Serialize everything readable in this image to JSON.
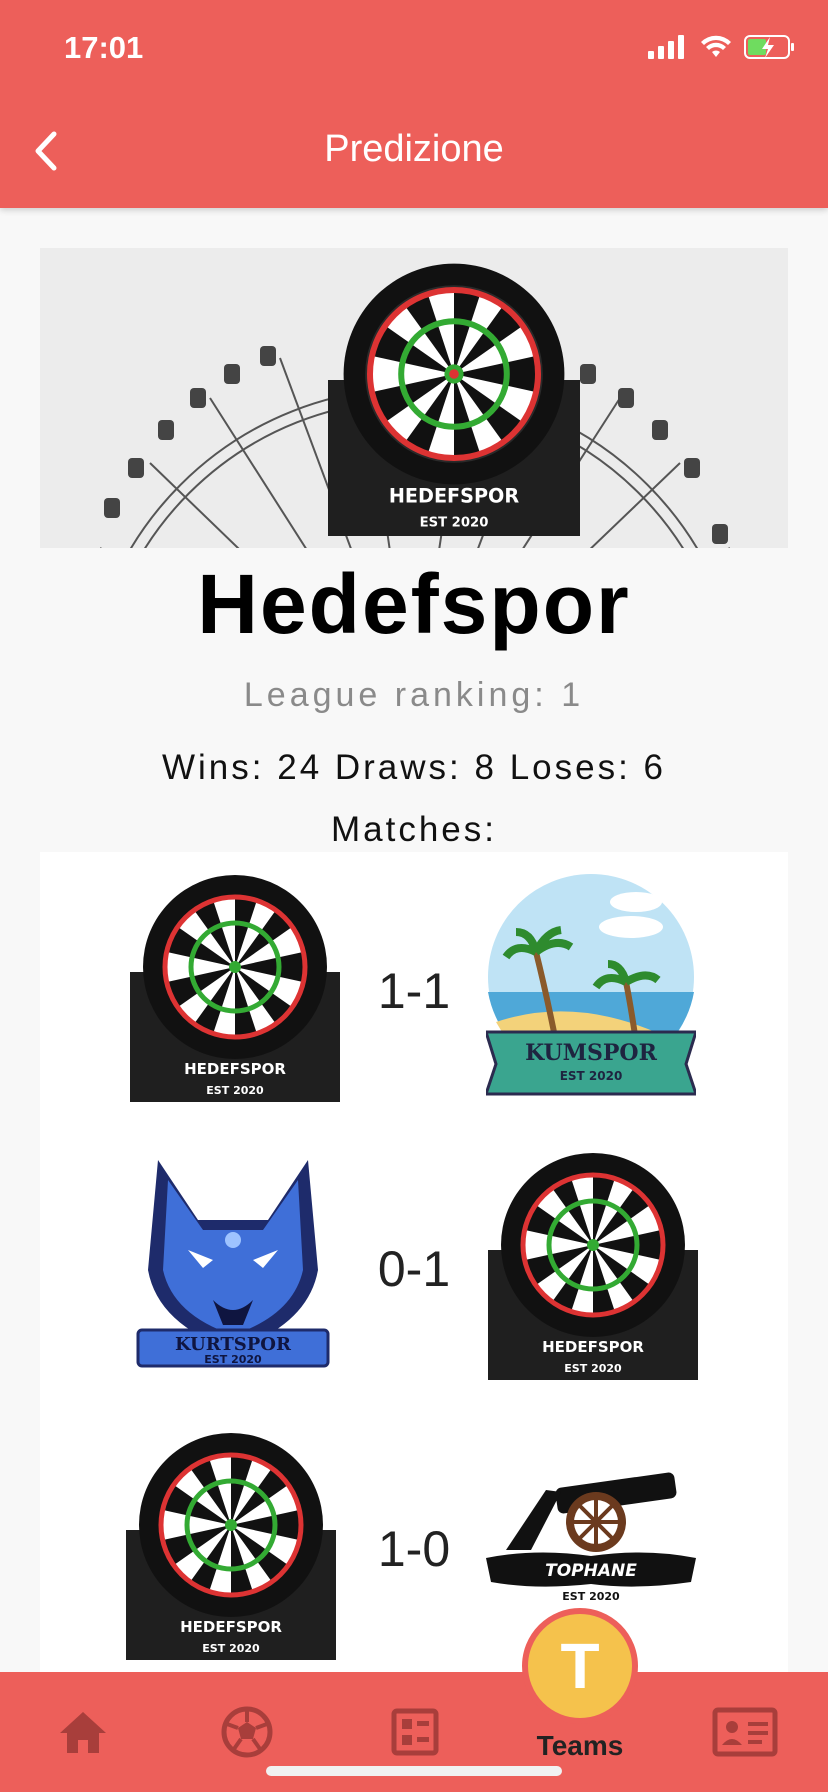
{
  "status_bar": {
    "time": "17:01"
  },
  "header": {
    "title": "Predizione"
  },
  "team": {
    "name": "Hedefspor",
    "ranking": "League ranking: 1",
    "record": "Wins: 24 Draws: 8 Loses: 6",
    "matches_label": "Matches:"
  },
  "banner_logo": {
    "name": "HEDEFSPOR",
    "est": "EST 2020"
  },
  "matches": [
    {
      "home": {
        "name": "HEDEFSPOR",
        "est": "EST 2020"
      },
      "score": "1-1",
      "away": {
        "name": "KUMSPOR",
        "est": "EST 2020"
      }
    },
    {
      "home": {
        "name": "KURTSPOR",
        "est": "EST 2020"
      },
      "score": "0-1",
      "away": {
        "name": "HEDEFSPOR",
        "est": "EST 2020"
      }
    },
    {
      "home": {
        "name": "HEDEFSPOR",
        "est": "EST 2020"
      },
      "score": "1-0",
      "away": {
        "name": "TOPHANE",
        "est": "EST 2020"
      }
    }
  ],
  "tabbar": {
    "items": [
      {
        "icon": "home-icon"
      },
      {
        "icon": "soccer-ball-icon"
      },
      {
        "icon": "schedule-icon"
      },
      {
        "icon": "teams-icon",
        "label": "Teams",
        "letter": "T"
      },
      {
        "icon": "profile-card-icon"
      }
    ]
  },
  "colors": {
    "accent": "#ed5f5a",
    "teams_badge": "#f5c24c"
  }
}
